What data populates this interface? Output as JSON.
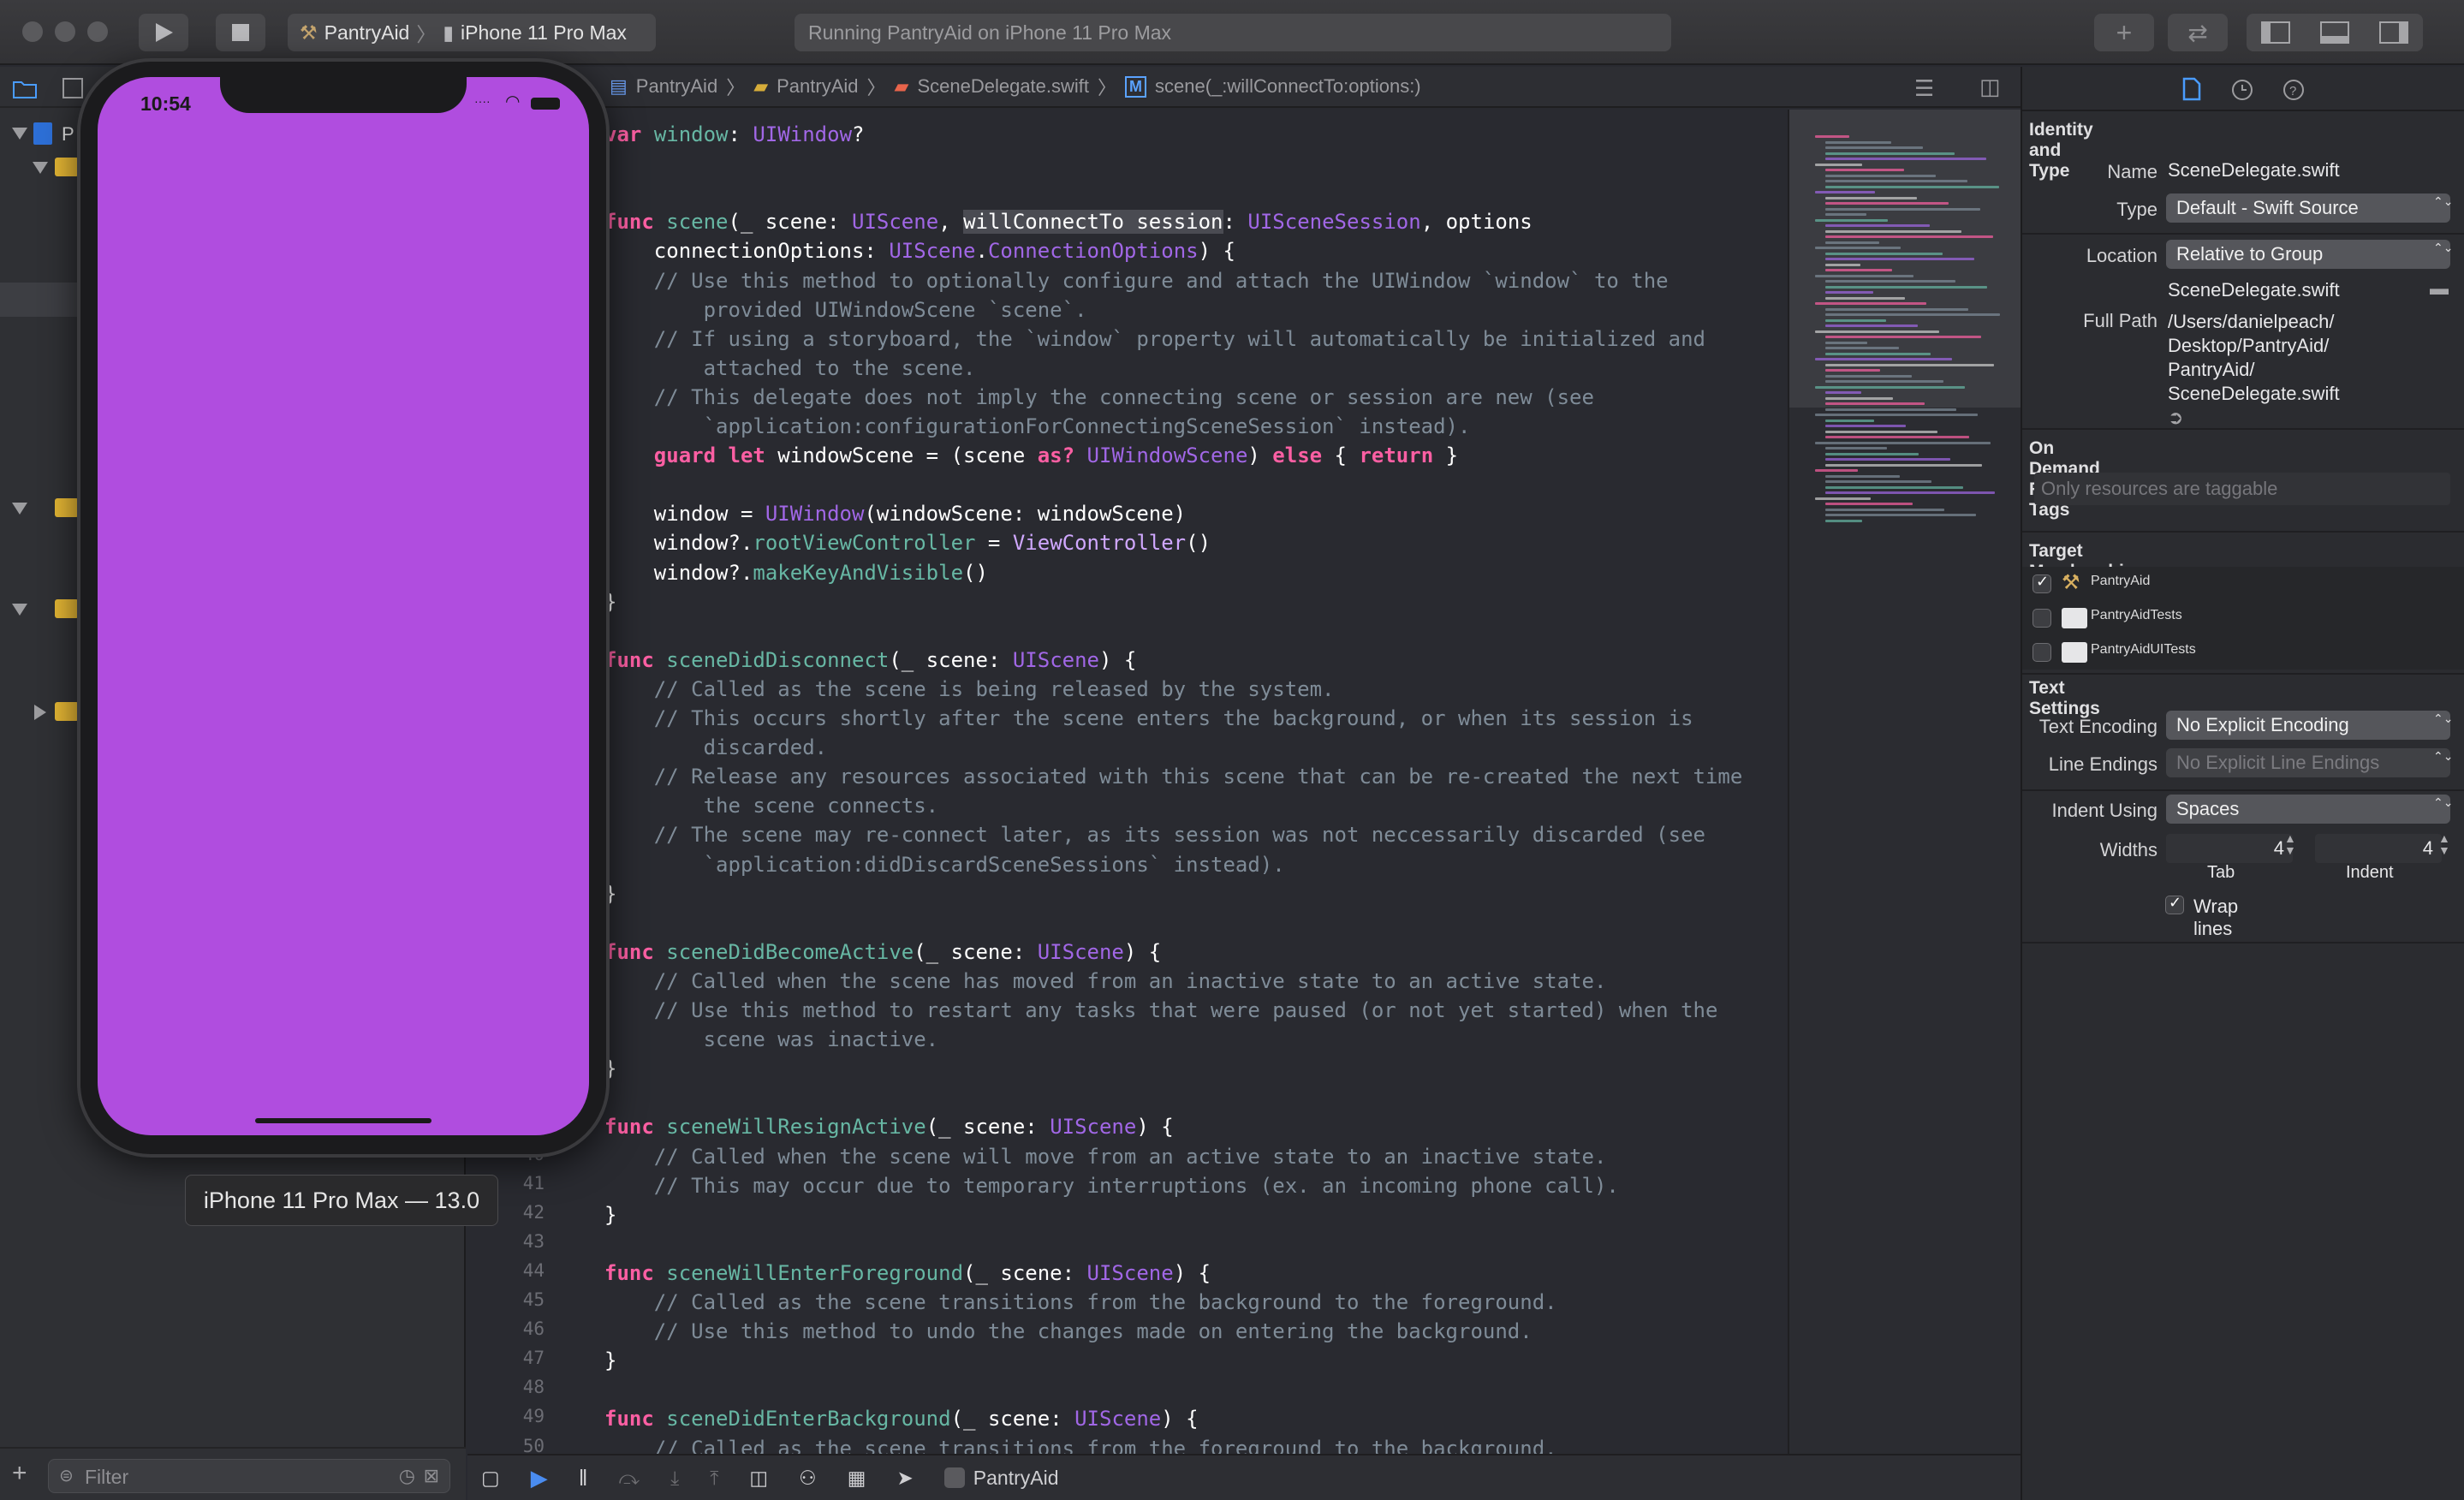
{
  "toolbar": {
    "scheme_name": "PantryAid",
    "device_name": "iPhone 11 Pro Max",
    "activity_text": "Running PantryAid on iPhone 11 Pro Max"
  },
  "navigator": {
    "root_label": "P",
    "filter_placeholder": "Filter"
  },
  "jumpbar": {
    "crumbs": [
      "PantryAid",
      "PantryAid",
      "SceneDelegate.swift",
      "scene(_:willConnectTo:options:)"
    ],
    "method_badge": "M"
  },
  "gutter": {
    "line_numbers": [
      "40",
      "41",
      "42",
      "43",
      "44",
      "45",
      "46",
      "47",
      "48",
      "49",
      "50"
    ]
  },
  "code": {
    "lines": [
      {
        "parts": [
          [
            "kw",
            "var"
          ],
          [
            "t",
            " "
          ],
          [
            "fn",
            "window"
          ],
          [
            "t",
            ": "
          ],
          [
            "cls",
            "UIWindow"
          ],
          [
            "t",
            "?"
          ]
        ]
      },
      {
        "parts": [
          [
            "t",
            ""
          ]
        ]
      },
      {
        "parts": [
          [
            "t",
            ""
          ]
        ]
      },
      {
        "parts": [
          [
            "kw",
            "func"
          ],
          [
            "t",
            " "
          ],
          [
            "fn",
            "scene"
          ],
          [
            "t",
            "(_ scene: "
          ],
          [
            "cls",
            "UIScene"
          ],
          [
            "t",
            ", "
          ],
          [
            "hl",
            "willConnectTo session"
          ],
          [
            "t",
            ": "
          ],
          [
            "cls",
            "UISceneSession"
          ],
          [
            "t",
            ", options"
          ]
        ]
      },
      {
        "parts": [
          [
            "t",
            "    connectionOptions: "
          ],
          [
            "cls",
            "UIScene"
          ],
          [
            "t",
            "."
          ],
          [
            "cls",
            "ConnectionOptions"
          ],
          [
            "t",
            ") {"
          ]
        ]
      },
      {
        "parts": [
          [
            "cm",
            "    // Use this method to optionally configure and attach the UIWindow `window` to the"
          ]
        ]
      },
      {
        "parts": [
          [
            "cm",
            "        provided UIWindowScene `scene`."
          ]
        ]
      },
      {
        "parts": [
          [
            "cm",
            "    // If using a storyboard, the `window` property will automatically be initialized and"
          ]
        ]
      },
      {
        "parts": [
          [
            "cm",
            "        attached to the scene."
          ]
        ]
      },
      {
        "parts": [
          [
            "cm",
            "    // This delegate does not imply the connecting scene or session are new (see"
          ]
        ]
      },
      {
        "parts": [
          [
            "cm",
            "        `application:configurationForConnectingSceneSession` instead)."
          ]
        ]
      },
      {
        "parts": [
          [
            "t",
            "    "
          ],
          [
            "kw",
            "guard let"
          ],
          [
            "t",
            " windowScene = (scene "
          ],
          [
            "kw",
            "as?"
          ],
          [
            "t",
            " "
          ],
          [
            "cls",
            "UIWindowScene"
          ],
          [
            "t",
            ") "
          ],
          [
            "kw",
            "else"
          ],
          [
            "t",
            " { "
          ],
          [
            "kw",
            "return"
          ],
          [
            "t",
            " }"
          ]
        ]
      },
      {
        "parts": [
          [
            "t",
            ""
          ]
        ]
      },
      {
        "parts": [
          [
            "t",
            "    window = "
          ],
          [
            "cls",
            "UIWindow"
          ],
          [
            "t",
            "(windowScene: windowScene)"
          ]
        ]
      },
      {
        "parts": [
          [
            "t",
            "    window?."
          ],
          [
            "mth",
            "rootViewController"
          ],
          [
            "t",
            " = "
          ],
          [
            "ty",
            "ViewController"
          ],
          [
            "t",
            "()"
          ]
        ]
      },
      {
        "parts": [
          [
            "t",
            "    window?."
          ],
          [
            "mth",
            "makeKeyAndVisible"
          ],
          [
            "t",
            "()"
          ]
        ]
      },
      {
        "parts": [
          [
            "t",
            "}"
          ]
        ]
      },
      {
        "parts": [
          [
            "t",
            ""
          ]
        ]
      },
      {
        "parts": [
          [
            "kw",
            "func"
          ],
          [
            "t",
            " "
          ],
          [
            "fn",
            "sceneDidDisconnect"
          ],
          [
            "t",
            "(_ scene: "
          ],
          [
            "cls",
            "UIScene"
          ],
          [
            "t",
            ") {"
          ]
        ]
      },
      {
        "parts": [
          [
            "cm",
            "    // Called as the scene is being released by the system."
          ]
        ]
      },
      {
        "parts": [
          [
            "cm",
            "    // This occurs shortly after the scene enters the background, or when its session is"
          ]
        ]
      },
      {
        "parts": [
          [
            "cm",
            "        discarded."
          ]
        ]
      },
      {
        "parts": [
          [
            "cm",
            "    // Release any resources associated with this scene that can be re-created the next time"
          ]
        ]
      },
      {
        "parts": [
          [
            "cm",
            "        the scene connects."
          ]
        ]
      },
      {
        "parts": [
          [
            "cm",
            "    // The scene may re-connect later, as its session was not neccessarily discarded (see"
          ]
        ]
      },
      {
        "parts": [
          [
            "cm",
            "        `application:didDiscardSceneSessions` instead)."
          ]
        ]
      },
      {
        "parts": [
          [
            "t",
            "}"
          ]
        ]
      },
      {
        "parts": [
          [
            "t",
            ""
          ]
        ]
      },
      {
        "parts": [
          [
            "kw",
            "func"
          ],
          [
            "t",
            " "
          ],
          [
            "fn",
            "sceneDidBecomeActive"
          ],
          [
            "t",
            "(_ scene: "
          ],
          [
            "cls",
            "UIScene"
          ],
          [
            "t",
            ") {"
          ]
        ]
      },
      {
        "parts": [
          [
            "cm",
            "    // Called when the scene has moved from an inactive state to an active state."
          ]
        ]
      },
      {
        "parts": [
          [
            "cm",
            "    // Use this method to restart any tasks that were paused (or not yet started) when the"
          ]
        ]
      },
      {
        "parts": [
          [
            "cm",
            "        scene was inactive."
          ]
        ]
      },
      {
        "parts": [
          [
            "t",
            "}"
          ]
        ]
      },
      {
        "parts": [
          [
            "t",
            ""
          ]
        ]
      },
      {
        "parts": [
          [
            "kw",
            "func"
          ],
          [
            "t",
            " "
          ],
          [
            "fn",
            "sceneWillResignActive"
          ],
          [
            "t",
            "(_ scene: "
          ],
          [
            "cls",
            "UIScene"
          ],
          [
            "t",
            ") {"
          ]
        ]
      },
      {
        "parts": [
          [
            "cm",
            "    // Called when the scene will move from an active state to an inactive state."
          ]
        ]
      },
      {
        "parts": [
          [
            "cm",
            "    // This may occur due to temporary interruptions (ex. an incoming phone call)."
          ]
        ]
      },
      {
        "parts": [
          [
            "t",
            "}"
          ]
        ]
      },
      {
        "parts": [
          [
            "t",
            ""
          ]
        ]
      },
      {
        "parts": [
          [
            "kw",
            "func"
          ],
          [
            "t",
            " "
          ],
          [
            "fn",
            "sceneWillEnterForeground"
          ],
          [
            "t",
            "(_ scene: "
          ],
          [
            "cls",
            "UIScene"
          ],
          [
            "t",
            ") {"
          ]
        ]
      },
      {
        "parts": [
          [
            "cm",
            "    // Called as the scene transitions from the background to the foreground."
          ]
        ]
      },
      {
        "parts": [
          [
            "cm",
            "    // Use this method to undo the changes made on entering the background."
          ]
        ]
      },
      {
        "parts": [
          [
            "t",
            "}"
          ]
        ]
      },
      {
        "parts": [
          [
            "t",
            ""
          ]
        ]
      },
      {
        "parts": [
          [
            "kw",
            "func"
          ],
          [
            "t",
            " "
          ],
          [
            "fn",
            "sceneDidEnterBackground"
          ],
          [
            "t",
            "(_ scene: "
          ],
          [
            "cls",
            "UIScene"
          ],
          [
            "t",
            ") {"
          ]
        ]
      },
      {
        "parts": [
          [
            "cm",
            "    // Called as the scene transitions from the foreground to the background."
          ]
        ]
      }
    ]
  },
  "debugbar": {
    "target": "PantryAid"
  },
  "inspector": {
    "identity_title": "Identity and Type",
    "name_label": "Name",
    "name_value": "SceneDelegate.swift",
    "type_label": "Type",
    "type_value": "Default - Swift Source",
    "location_label": "Location",
    "location_value": "Relative to Group",
    "location_file": "SceneDelegate.swift",
    "fullpath_label": "Full Path",
    "fullpath_lines": [
      "/Users/danielpeach/",
      "Desktop/PantryAid/",
      "PantryAid/",
      "SceneDelegate.swift"
    ],
    "odr_title": "On Demand Resource Tags",
    "odr_placeholder": "Only resources are taggable",
    "target_title": "Target Membership",
    "targets": [
      {
        "name": "PantryAid",
        "checked": true
      },
      {
        "name": "PantryAidTests",
        "checked": false
      },
      {
        "name": "PantryAidUITests",
        "checked": false
      }
    ],
    "text_title": "Text Settings",
    "encoding_label": "Text Encoding",
    "encoding_value": "No Explicit Encoding",
    "endings_label": "Line Endings",
    "endings_value": "No Explicit Line Endings",
    "indent_label": "Indent Using",
    "indent_value": "Spaces",
    "widths_label": "Widths",
    "tab_width": "4",
    "indent_width": "4",
    "tab_label": "Tab",
    "indent_sub_label": "Indent",
    "wrap_label": "Wrap lines"
  },
  "simulator": {
    "time": "10:54",
    "screen_color": "#b04ddf",
    "device_label": "iPhone 11 Pro Max — 13.0"
  }
}
